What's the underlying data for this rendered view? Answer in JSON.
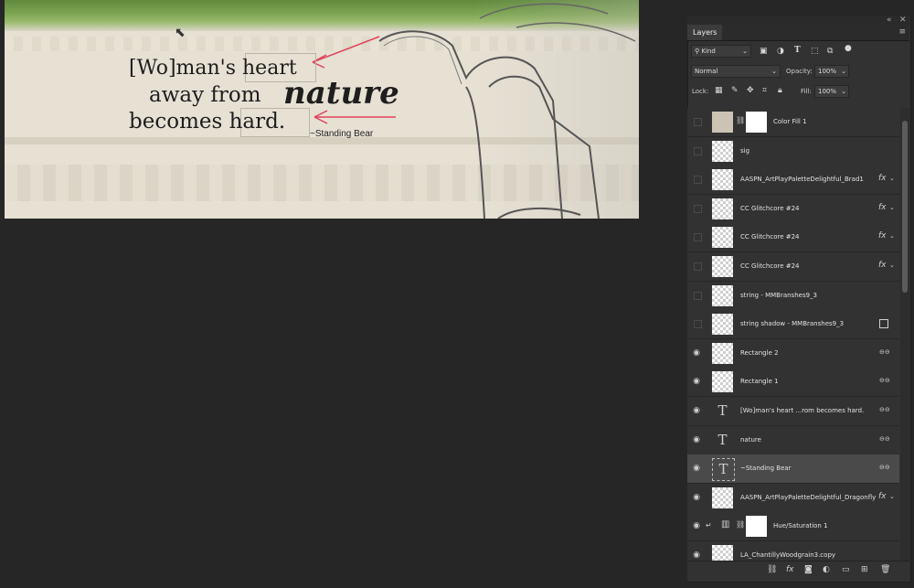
{
  "canvas": {
    "line1": "[Wo]man's heart",
    "line2": "away from",
    "line2_script": "nature",
    "line3": "becomes hard.",
    "signature": "~Standing Bear",
    "arrow_color": "#e0425a"
  },
  "panel": {
    "tab_title": "Layers",
    "collapse_icon": "«",
    "close_icon": "✕",
    "menu_icon": "≡",
    "filter_kind": "Kind",
    "blend_mode": "Normal",
    "opacity_label": "Opacity:",
    "opacity_value": "100%",
    "lock_label": "Lock:",
    "fill_label": "Fill:",
    "fill_value": "100%"
  },
  "layers": [
    {
      "name": "Color Fill 1",
      "visible": false,
      "thumb": "fill",
      "mask": true,
      "badge": ""
    },
    {
      "name": "sig",
      "visible": false,
      "thumb": "pixel",
      "badge": ""
    },
    {
      "name": "AASPN_ArtPlayPaletteDelightful_Brad1",
      "visible": false,
      "thumb": "pixel",
      "badge": "fx"
    },
    {
      "name": "CC Glitchcore #24",
      "visible": false,
      "thumb": "pixel",
      "badge": "fx"
    },
    {
      "name": "CC Glitchcore #24",
      "visible": false,
      "thumb": "pixel",
      "badge": "fx"
    },
    {
      "name": "CC Glitchcore #24",
      "visible": false,
      "thumb": "pixel",
      "badge": "fx"
    },
    {
      "name": "string - MMBranshes9_3",
      "visible": false,
      "thumb": "pixel",
      "badge": ""
    },
    {
      "name": "string shadow - MMBranshes9_3",
      "visible": false,
      "thumb": "pixel",
      "badge": "smart"
    },
    {
      "name": "Rectangle 2",
      "visible": true,
      "thumb": "pixel",
      "badge": "link"
    },
    {
      "name": "Rectangle 1",
      "visible": true,
      "thumb": "pixel",
      "badge": "link"
    },
    {
      "name": "[Wo]man's heart     ...rom becomes hard.",
      "visible": true,
      "thumb": "text",
      "badge": "link"
    },
    {
      "name": "nature",
      "visible": true,
      "thumb": "text",
      "badge": "link"
    },
    {
      "name": "~Standing Bear",
      "visible": true,
      "thumb": "text",
      "badge": "link",
      "selected": true
    },
    {
      "name": "AASPN_ArtPlayPaletteDelightful_Dragonfly",
      "visible": true,
      "thumb": "pixel",
      "badge": "fx"
    },
    {
      "name": "Hue/Saturation 1",
      "visible": true,
      "thumb": "adjust",
      "mask": true,
      "badge": ""
    },
    {
      "name": "LA_ChantillyWoodgrain3.copy",
      "visible": true,
      "thumb": "pixel",
      "badge": ""
    }
  ],
  "footer_icons": [
    "link-layers-icon",
    "fx-icon",
    "add-mask-icon",
    "adjustment-icon",
    "folder-icon",
    "new-layer-icon",
    "trash-icon"
  ]
}
